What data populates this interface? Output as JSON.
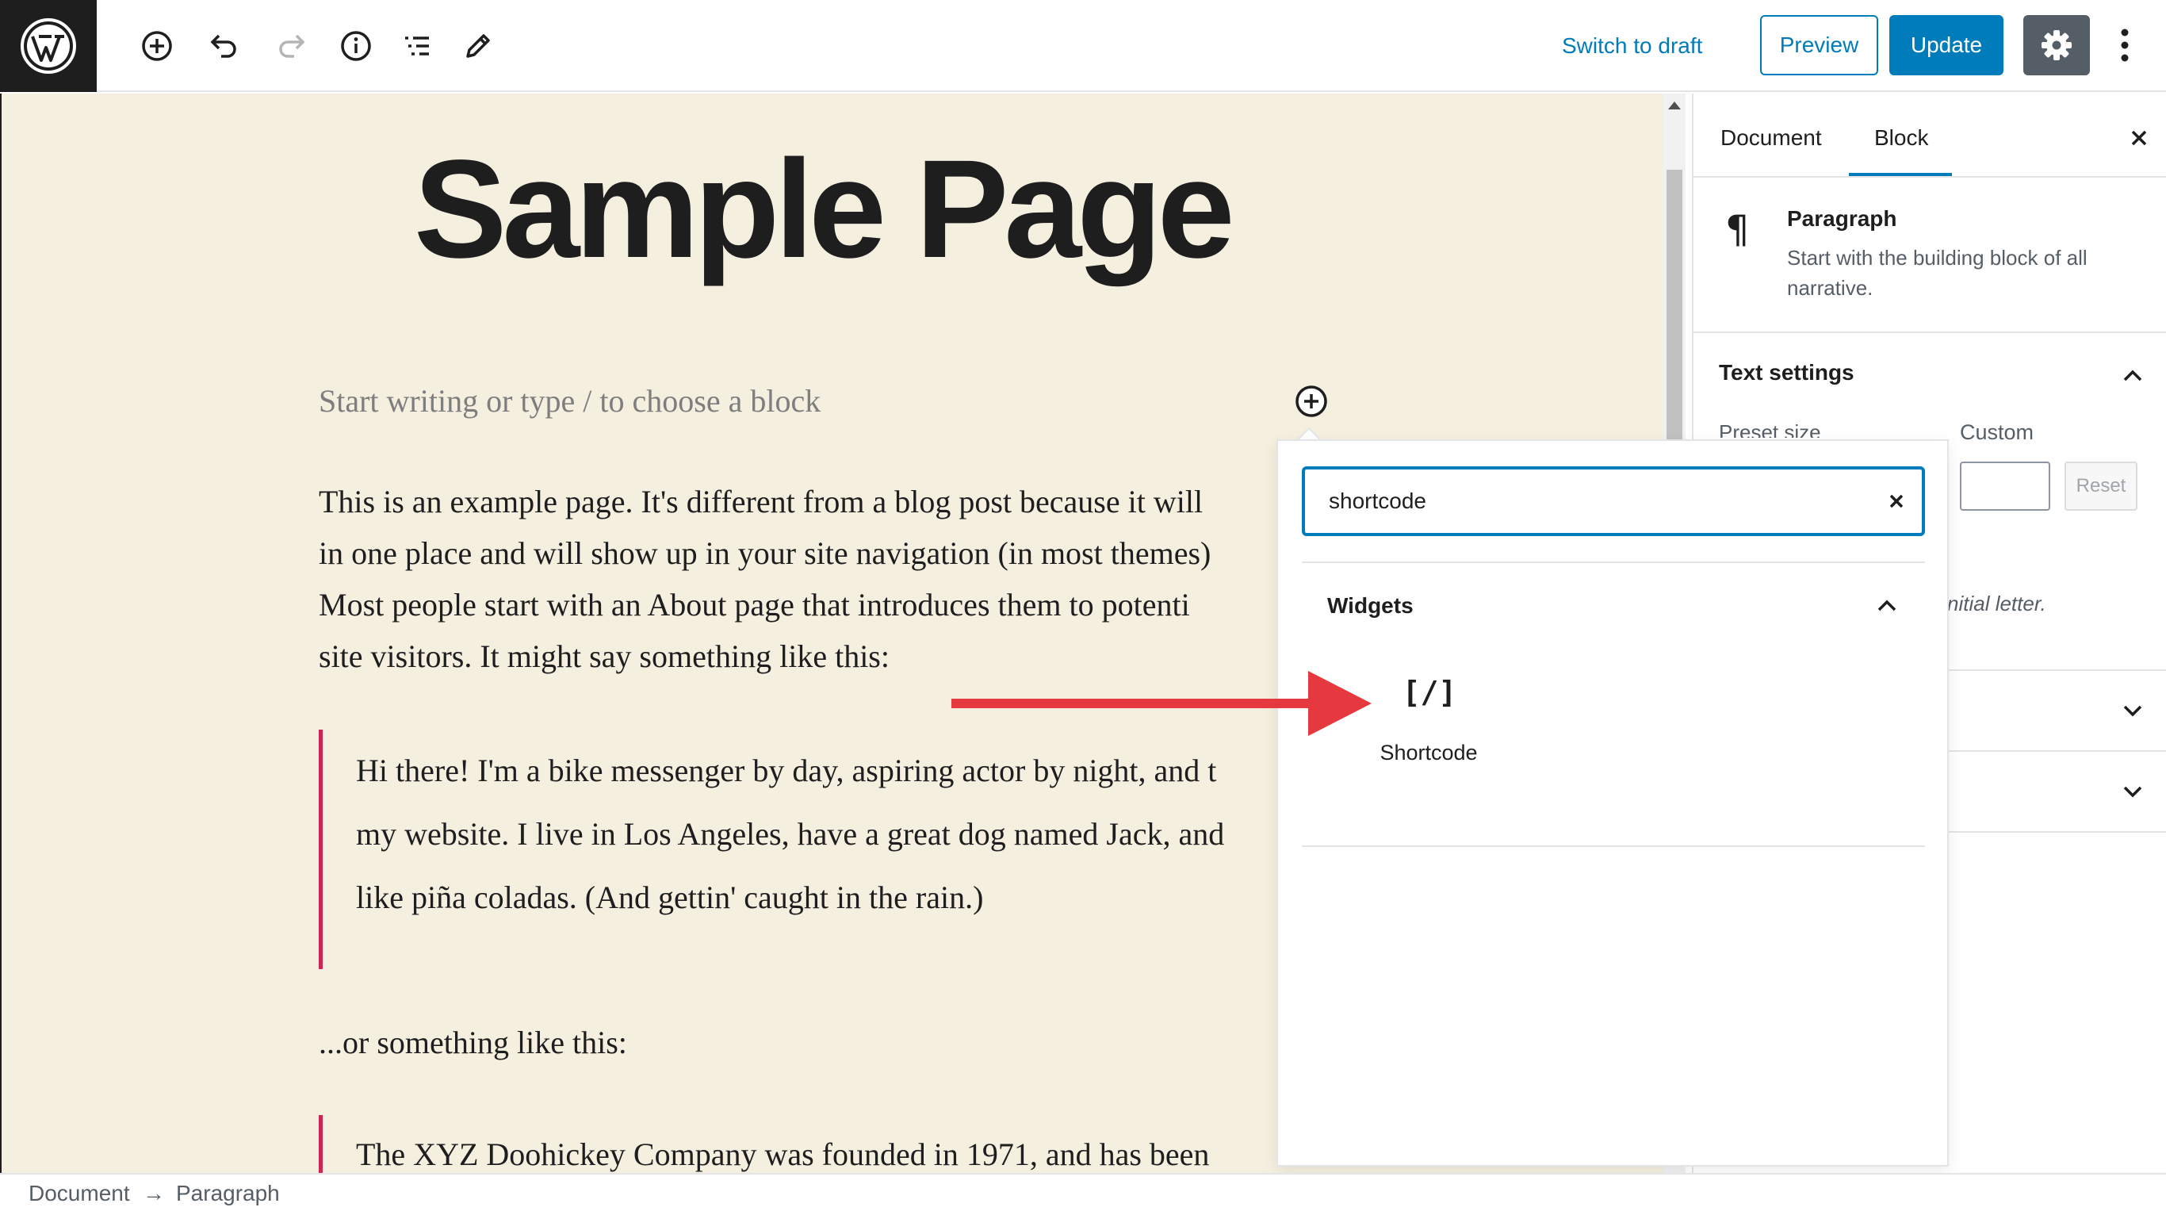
{
  "toolbar": {
    "switch_to_draft": "Switch to draft",
    "preview": "Preview",
    "update": "Update"
  },
  "editor": {
    "title": "Sample Page",
    "placeholder": "Start writing or type / to choose a block",
    "paragraph_lines": [
      "This is an example page. It's different from a blog post because it will",
      "in one place and will show up in your site navigation (in most themes)",
      "Most people start with an About page that introduces them to potenti",
      "site visitors. It might say something like this:"
    ],
    "quote1_lines": [
      "Hi there! I'm a bike messenger by day, aspiring actor by night, and t",
      "my website. I live in Los Angeles, have a great dog named Jack, and",
      "like piña coladas. (And gettin' caught in the rain.)"
    ],
    "paragraph2": "...or something like this:",
    "quote2_lines": [
      "The XYZ Doohickey Company was founded in 1971, and has been"
    ]
  },
  "sidebar": {
    "tabs": [
      "Document",
      "Block"
    ],
    "active_tab": "Block",
    "block": {
      "icon": "paragraph-icon",
      "name": "Paragraph",
      "description": "Start with the building block of all narrative."
    },
    "text_settings": {
      "title": "Text settings",
      "preset_label": "Preset size",
      "custom_label": "Custom",
      "reset_label": "Reset",
      "drop_cap_help": "nitial letter."
    }
  },
  "inserter": {
    "search_value": "shortcode",
    "category": "Widgets",
    "items": [
      {
        "icon": "shortcode-icon",
        "glyph": "[/]",
        "label": "Shortcode"
      }
    ]
  },
  "breadcrumb": [
    "Document",
    "→",
    "Paragraph"
  ],
  "colors": {
    "accent": "#007cba",
    "canvas_bg": "#f5efe0",
    "quote_bar": "#cd2653",
    "annotation_arrow": "#e6393f",
    "settings_bg": "#555d66"
  }
}
